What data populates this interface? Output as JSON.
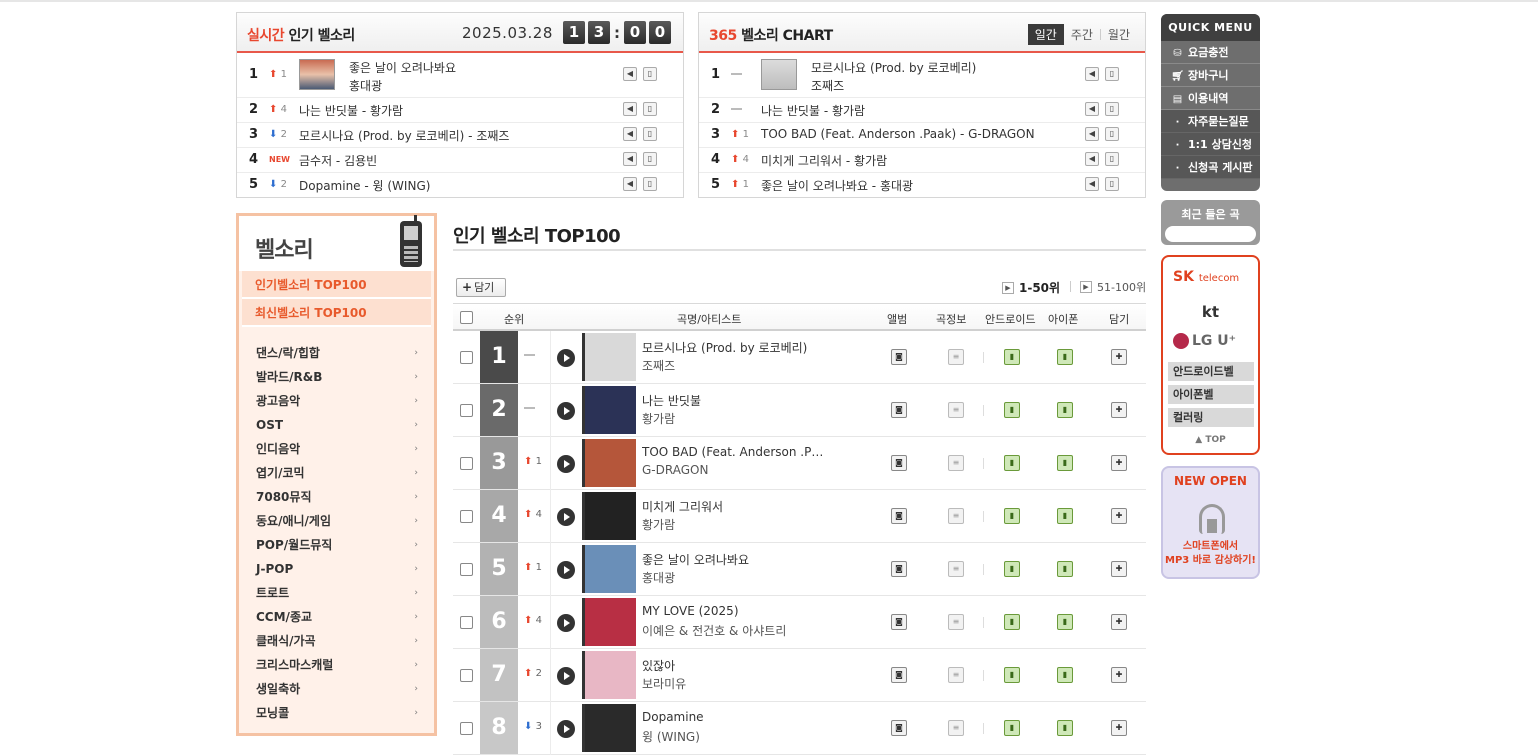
{
  "realtime": {
    "title_red": "실시간",
    "title_rest": " 인기 벨소리",
    "date": "2025.03.28",
    "clock": [
      "1",
      "3",
      "0",
      "0"
    ],
    "items": [
      {
        "rank": "1",
        "change": "1",
        "dir": "up",
        "title": "좋은 날이 오려나봐요",
        "artist": "홍대광"
      },
      {
        "rank": "2",
        "change": "4",
        "dir": "up",
        "title": "나는 반딧불 - 황가람"
      },
      {
        "rank": "3",
        "change": "2",
        "dir": "down",
        "title": "모르시나요 (Prod. by 로코베리) - 조째즈"
      },
      {
        "rank": "4",
        "change": "NEW",
        "dir": "new",
        "title": "금수저 - 김용빈"
      },
      {
        "rank": "5",
        "change": "2",
        "dir": "down",
        "title": "Dopamine - 윙 (WING)"
      }
    ]
  },
  "chart365": {
    "title_red": "365",
    "title_rest": " 벨소리 CHART",
    "tabs": [
      "일간",
      "주간",
      "월간"
    ],
    "items": [
      {
        "rank": "1",
        "change": "",
        "dir": "same",
        "title": "모르시나요 (Prod. by 로코베리)",
        "artist": "조째즈"
      },
      {
        "rank": "2",
        "change": "",
        "dir": "same",
        "title": "나는 반딧불 - 황가람"
      },
      {
        "rank": "3",
        "change": "1",
        "dir": "up",
        "title": "TOO BAD (Feat. Anderson .Paak) - G-DRAGON"
      },
      {
        "rank": "4",
        "change": "4",
        "dir": "up",
        "title": "미치게 그리워서 - 황가람"
      },
      {
        "rank": "5",
        "change": "1",
        "dir": "up",
        "title": "좋은 날이 오려나봐요 - 홍대광"
      }
    ]
  },
  "leftmenu": {
    "title": "벨소리",
    "highlight": [
      "인기벨소리 TOP100",
      "최신벨소리 TOP100"
    ],
    "categories": [
      "댄스/락/힙합",
      "발라드/R&B",
      "광고음악",
      "OST",
      "인디음악",
      "엽기/코믹",
      "7080뮤직",
      "동요/애니/게임",
      "POP/월드뮤직",
      "J-POP",
      "트로트",
      "CCM/종교",
      "클래식/가곡",
      "크리스마스캐럴",
      "생일축하",
      "모닝콜"
    ]
  },
  "main": {
    "title": "인기 벨소리 TOP100",
    "add_label": "담기",
    "page1": "1-50위",
    "page2": "51-100위",
    "headers": {
      "rank": "순위",
      "song": "곡명/아티스트",
      "album": "앨범",
      "info": "곡정보",
      "android": "안드로이드",
      "iphone": "아이폰",
      "add": "담기"
    },
    "rows": [
      {
        "rank": "1",
        "change": "",
        "dir": "same",
        "song": "모르시나요 (Prod. by 로코베리)",
        "artist": "조째즈",
        "cover": "#d9d9d9"
      },
      {
        "rank": "2",
        "change": "",
        "dir": "same",
        "song": "나는 반딧불",
        "artist": "황가람",
        "cover": "#2b3256"
      },
      {
        "rank": "3",
        "change": "1",
        "dir": "up",
        "song": "TOO BAD (Feat. Anderson .P…",
        "artist": "G-DRAGON",
        "cover": "#b5563a"
      },
      {
        "rank": "4",
        "change": "4",
        "dir": "up",
        "song": "미치게 그리워서",
        "artist": "황가람",
        "cover": "#222222"
      },
      {
        "rank": "5",
        "change": "1",
        "dir": "up",
        "song": "좋은 날이 오려나봐요",
        "artist": "홍대광",
        "cover": "#6a8fb8"
      },
      {
        "rank": "6",
        "change": "4",
        "dir": "up",
        "song": "MY LOVE (2025)",
        "artist": "이예은 & 전건호 & 아샤트리",
        "cover": "#b82f44"
      },
      {
        "rank": "7",
        "change": "2",
        "dir": "up",
        "song": "있잖아",
        "artist": "보라미유",
        "cover": "#e8b7c5"
      },
      {
        "rank": "8",
        "change": "3",
        "dir": "down",
        "song": "Dopamine",
        "artist": "윙 (WING)",
        "cover": "#2a2a2a"
      }
    ]
  },
  "quickmenu": {
    "title": "QUICK MENU",
    "items": [
      "요금충전",
      "장바구니",
      "이용내역"
    ],
    "sub": [
      "자주묻는질문",
      "1:1 상담신청",
      "신청곡 게시판"
    ],
    "recent": "최근 들은 곡"
  },
  "carriers": {
    "sk": "SK",
    "sk_sub": "telecom",
    "kt": "kt",
    "lg": "LG U⁺",
    "links": [
      "안드로이드벨",
      "아이폰벨",
      "컬러링"
    ],
    "top": "TOP"
  },
  "newopen": {
    "title": "NEW OPEN",
    "line1": "스마트폰에서",
    "line2": "MP3 바로 감상하기!"
  }
}
